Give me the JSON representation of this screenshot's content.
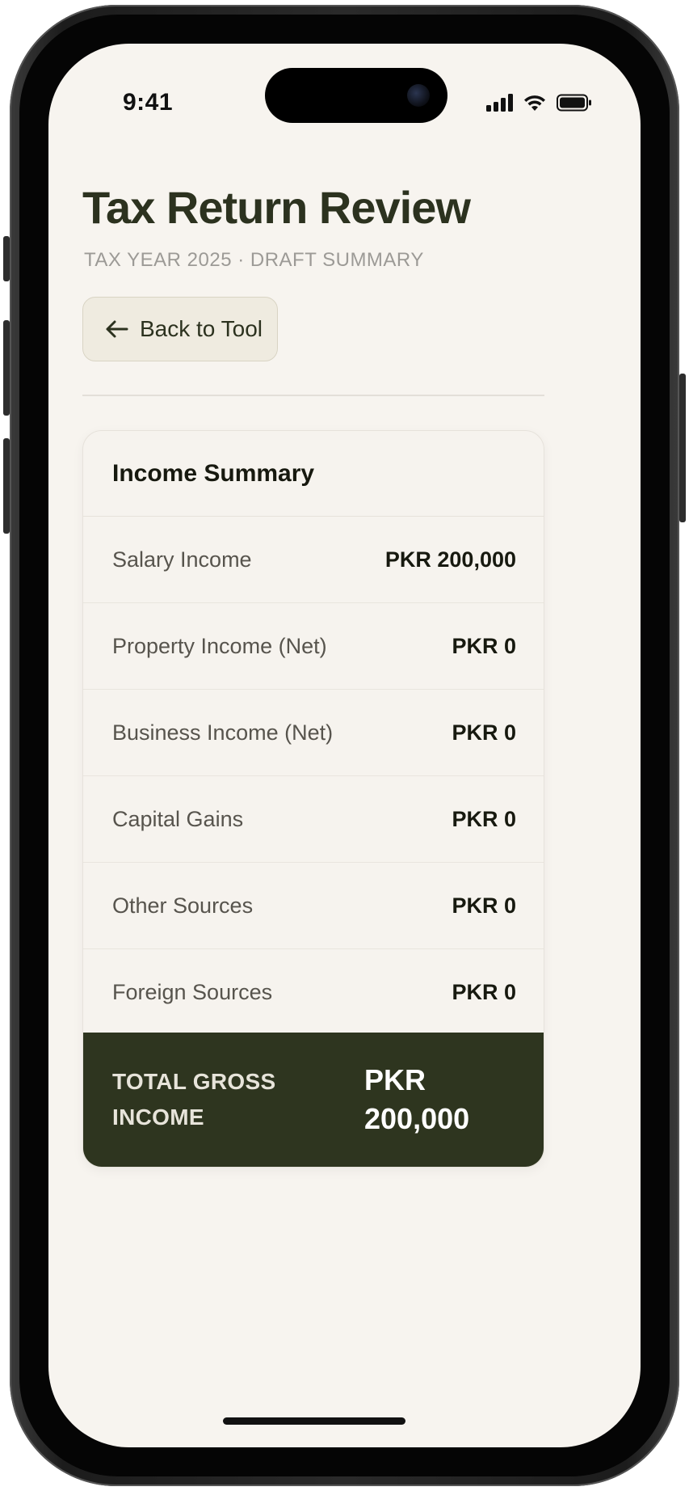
{
  "status_bar": {
    "time": "9:41"
  },
  "header": {
    "title": "Tax Return Review",
    "subtitle": "TAX YEAR 2025 · DRAFT SUMMARY"
  },
  "back_button": {
    "label": "Back to Tool",
    "icon": "arrow-left-icon"
  },
  "income_summary": {
    "heading": "Income Summary",
    "rows": [
      {
        "label": "Salary Income",
        "value": "PKR 200,000"
      },
      {
        "label": "Property Income (Net)",
        "value": "PKR 0"
      },
      {
        "label": "Business Income (Net)",
        "value": "PKR 0"
      },
      {
        "label": "Capital Gains",
        "value": "PKR 0"
      },
      {
        "label": "Other Sources",
        "value": "PKR 0"
      },
      {
        "label": "Foreign Sources",
        "value": "PKR 0"
      }
    ],
    "total": {
      "label_line1": "TOTAL GROSS",
      "label_line2": "INCOME",
      "value_line1": "PKR",
      "value_line2": "200,000"
    }
  },
  "colors": {
    "background": "#f7f4ef",
    "title": "#2c321f",
    "total_band": "#2e351f",
    "button_bg": "#efebe0"
  }
}
